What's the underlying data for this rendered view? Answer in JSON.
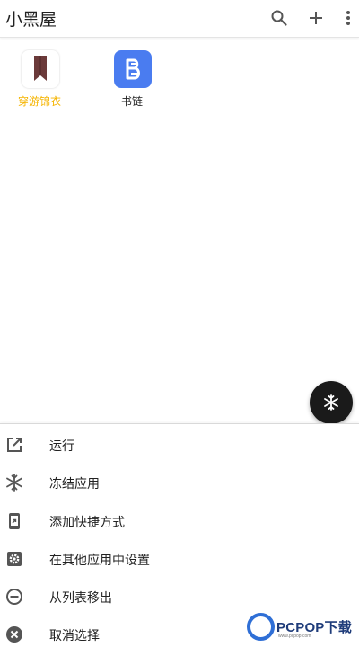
{
  "appbar": {
    "title": "小黑屋",
    "icons": [
      "search-icon",
      "add-icon",
      "more-vert-icon"
    ]
  },
  "apps": [
    {
      "label": "穿游锦衣",
      "icon": "bookmark-app-icon",
      "label_color": "#f5b400"
    },
    {
      "label": "书链",
      "icon": "b-link-app-icon",
      "icon_bg": "#4a7cf0"
    }
  ],
  "fab": {
    "icon": "snowflake-icon",
    "color": "#1a1a1a"
  },
  "menu": {
    "items": [
      {
        "label": "运行",
        "icon": "open-external-icon"
      },
      {
        "label": "冻结应用",
        "icon": "snowflake-icon"
      },
      {
        "label": "添加快捷方式",
        "icon": "phone-shortcut-icon"
      },
      {
        "label": "在其他应用中设置",
        "icon": "settings-gear-icon"
      },
      {
        "label": "从列表移出",
        "icon": "remove-circle-icon"
      },
      {
        "label": "取消选择",
        "icon": "cancel-circle-icon"
      }
    ]
  },
  "watermark": {
    "text": "PCPOP下载",
    "sub": "www.pcpop.com"
  }
}
